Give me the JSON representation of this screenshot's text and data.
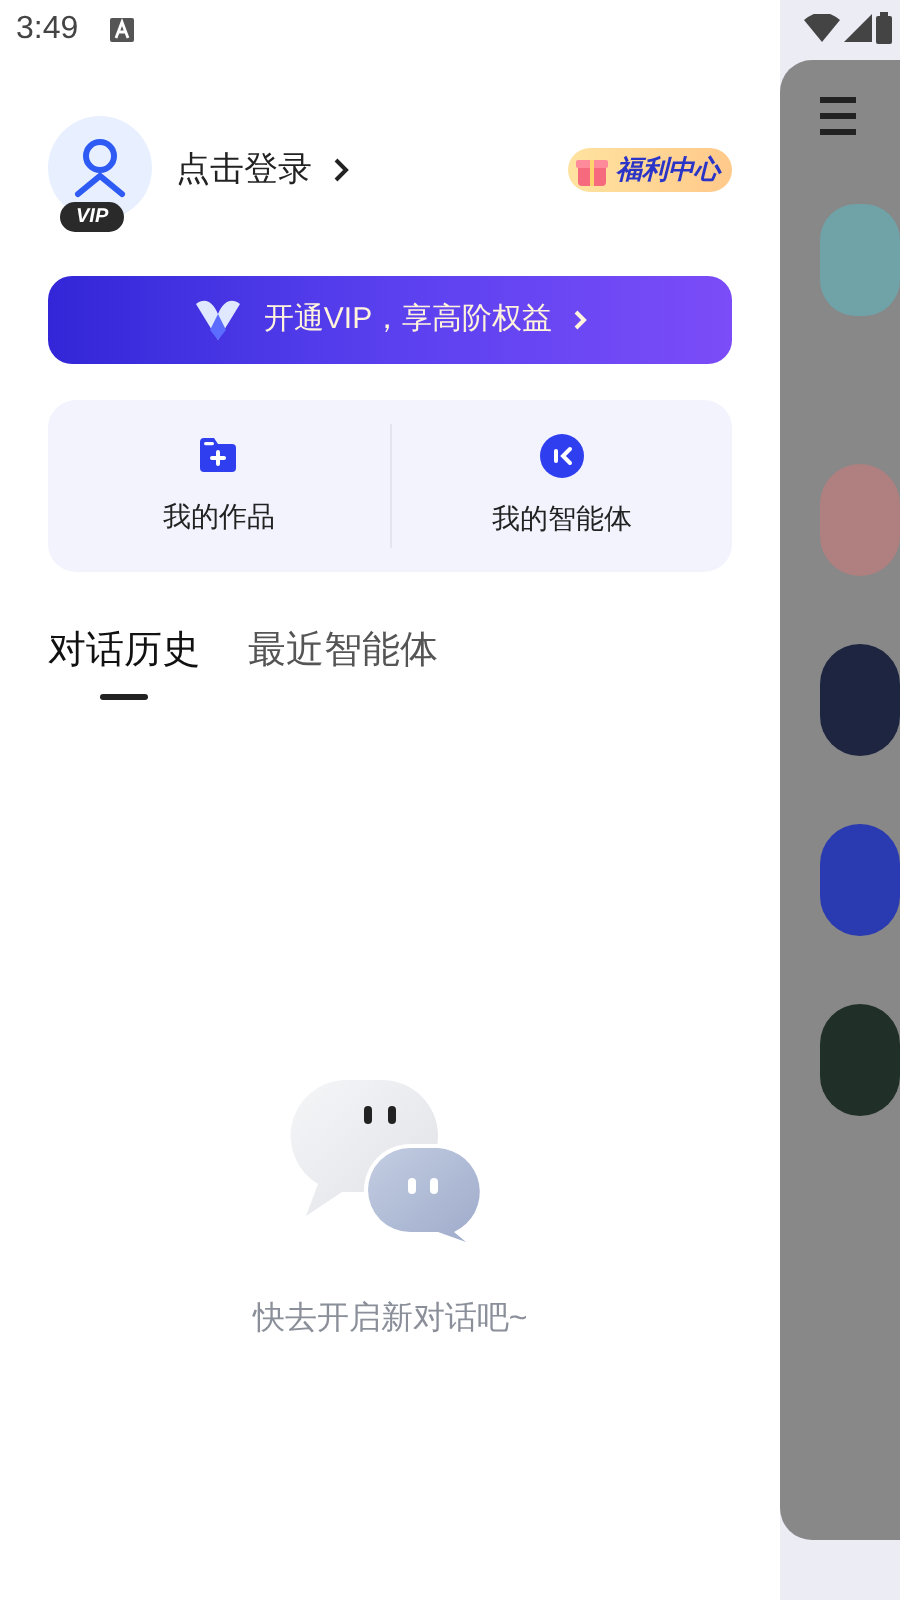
{
  "status_bar": {
    "time": "3:49"
  },
  "profile": {
    "login": "点击登录",
    "vip_badge": "VIP",
    "welfare": "福利中心"
  },
  "vip_banner": {
    "label": "开通VIP，享高阶权益"
  },
  "shortcuts": [
    {
      "kind": "works",
      "label": "我的作品"
    },
    {
      "kind": "agents",
      "label": "我的智能体"
    }
  ],
  "tabs": [
    {
      "label": "对话历史",
      "selected": true
    },
    {
      "label": "最近智能体",
      "selected": false
    }
  ],
  "empty_state": {
    "message": "快去开启新对话吧~"
  }
}
